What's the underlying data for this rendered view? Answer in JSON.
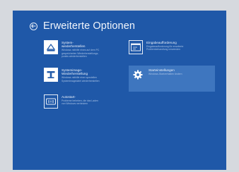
{
  "screen": {
    "title": "Erweiterte Optionen",
    "back_icon": "back-arrow-icon"
  },
  "options": [
    {
      "title_lines": [
        "System-",
        "wiederherstellen"
      ],
      "description": [
        "Windows mithilfe eines auf dem PC",
        "gespeicherten Wiederherstellungs-",
        "punkts wiederherstellen"
      ],
      "icon": "system-restore-icon"
    },
    {
      "title_lines": [
        "Eingabeaufforderung"
      ],
      "description": [
        "Eingabeaufforderung für erweiterte",
        "Problembehandlung verwenden"
      ],
      "icon": "command-prompt-icon"
    },
    {
      "title_lines": [
        "Systemimage-",
        "Wiederherstellung"
      ],
      "description": [
        "Windows mithilfe einer speziellen",
        "Systemimagedatei wiederherstellen"
      ],
      "icon": "system-image-recovery-icon"
    },
    {
      "title_lines": [
        "Starteinstellungen"
      ],
      "description": [
        "Windows-Startverhalten ändern"
      ],
      "icon": "startup-settings-gear-icon"
    },
    {
      "title_lines": [
        "Autostart-",
        "Reparatur"
      ],
      "description": [
        "Probleme beheben, die das Laden",
        "von Windows verhindern"
      ],
      "icon": "startup-repair-icon"
    }
  ]
}
